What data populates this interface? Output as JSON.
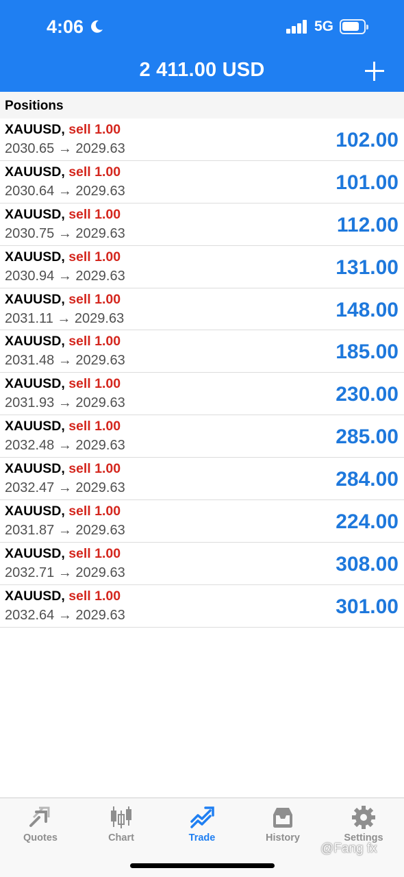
{
  "status_bar": {
    "time": "4:06",
    "network": "5G"
  },
  "header": {
    "balance": "2 411.00 USD"
  },
  "section": {
    "title": "Positions"
  },
  "positions": [
    {
      "symbol": "XAUUSD,",
      "side": "sell 1.00",
      "prices": "2030.65 → 2029.63",
      "profit": "102.00"
    },
    {
      "symbol": "XAUUSD,",
      "side": "sell 1.00",
      "prices": "2030.64 → 2029.63",
      "profit": "101.00"
    },
    {
      "symbol": "XAUUSD,",
      "side": "sell 1.00",
      "prices": "2030.75 → 2029.63",
      "profit": "112.00"
    },
    {
      "symbol": "XAUUSD,",
      "side": "sell 1.00",
      "prices": "2030.94 → 2029.63",
      "profit": "131.00"
    },
    {
      "symbol": "XAUUSD,",
      "side": "sell 1.00",
      "prices": "2031.11 → 2029.63",
      "profit": "148.00"
    },
    {
      "symbol": "XAUUSD,",
      "side": "sell 1.00",
      "prices": "2031.48 → 2029.63",
      "profit": "185.00"
    },
    {
      "symbol": "XAUUSD,",
      "side": "sell 1.00",
      "prices": "2031.93 → 2029.63",
      "profit": "230.00"
    },
    {
      "symbol": "XAUUSD,",
      "side": "sell 1.00",
      "prices": "2032.48 → 2029.63",
      "profit": "285.00"
    },
    {
      "symbol": "XAUUSD,",
      "side": "sell 1.00",
      "prices": "2032.47 → 2029.63",
      "profit": "284.00"
    },
    {
      "symbol": "XAUUSD,",
      "side": "sell 1.00",
      "prices": "2031.87 → 2029.63",
      "profit": "224.00"
    },
    {
      "symbol": "XAUUSD,",
      "side": "sell 1.00",
      "prices": "2032.71 → 2029.63",
      "profit": "308.00"
    },
    {
      "symbol": "XAUUSD,",
      "side": "sell 1.00",
      "prices": "2032.64 → 2029.63",
      "profit": "301.00"
    }
  ],
  "tabs": [
    {
      "label": "Quotes",
      "icon": "quotes-icon"
    },
    {
      "label": "Chart",
      "icon": "chart-icon"
    },
    {
      "label": "Trade",
      "icon": "trade-icon",
      "active": true
    },
    {
      "label": "History",
      "icon": "history-icon"
    },
    {
      "label": "Settings",
      "icon": "gear-icon"
    }
  ],
  "watermark": "@Fang fx",
  "colors": {
    "header": "#1f7ff2",
    "sell": "#d4261d",
    "profit": "#1e78dc",
    "tab_active": "#1f7ff2",
    "tab_inactive": "#8e8e8e"
  }
}
